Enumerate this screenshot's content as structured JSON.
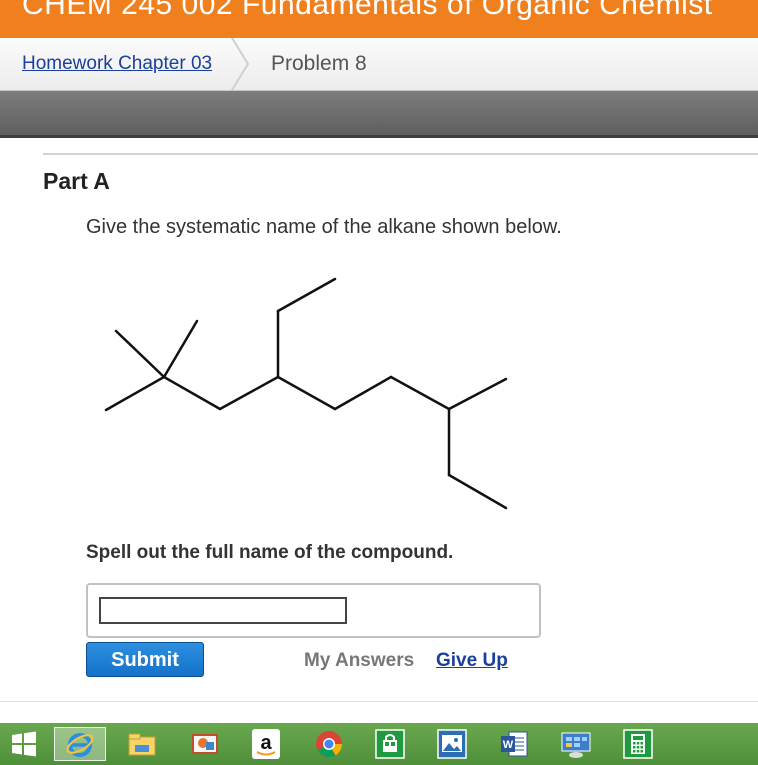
{
  "window": {
    "title": "CHEM 245 002 Fundamentals of Organic Chemist"
  },
  "breadcrumb": {
    "parent": "Homework Chapter 03",
    "current": "Problem 8"
  },
  "part": {
    "title": "Part A",
    "prompt": "Give the systematic name of the alkane shown below.",
    "instruction": "Spell out the full name of the compound.",
    "answer": {
      "value": "",
      "placeholder": ""
    }
  },
  "actions": {
    "submit": "Submit",
    "my_answers": "My Answers",
    "give_up": "Give Up"
  },
  "taskbar": {
    "items": [
      {
        "name": "windows-start-icon"
      },
      {
        "name": "internet-explorer-icon"
      },
      {
        "name": "file-explorer-icon"
      },
      {
        "name": "photo-app-icon"
      },
      {
        "name": "amazon-icon",
        "glyph": "a"
      },
      {
        "name": "chrome-icon"
      },
      {
        "name": "store-icon"
      },
      {
        "name": "photos-icon"
      },
      {
        "name": "word-icon",
        "glyph": "W"
      },
      {
        "name": "control-panel-icon"
      },
      {
        "name": "calculator-icon"
      }
    ]
  },
  "colors": {
    "header": "#f0801e",
    "accent": "#1472c9",
    "link": "#1a3f9c",
    "taskbar": "#5d9b45"
  }
}
